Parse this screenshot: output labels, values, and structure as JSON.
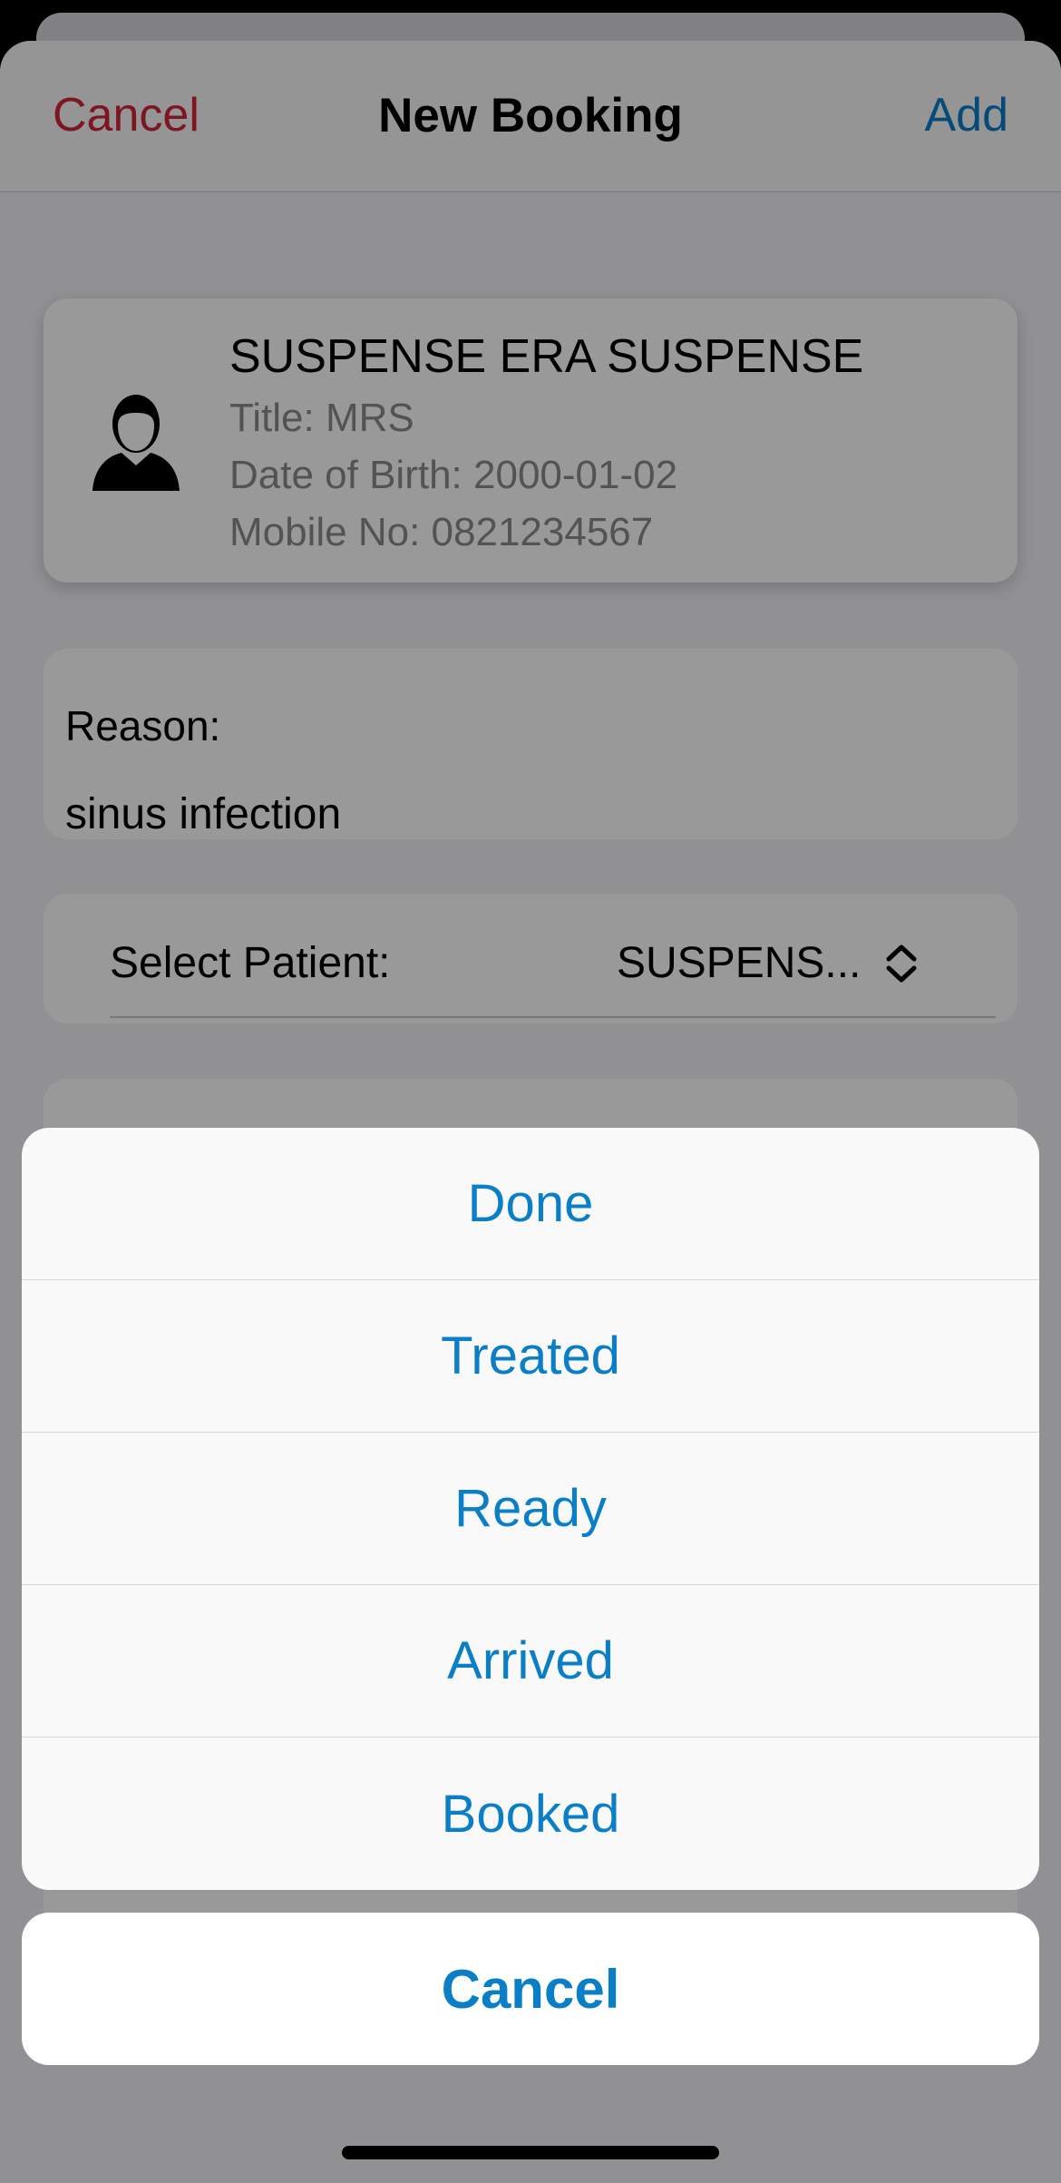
{
  "navbar": {
    "cancel_label": "Cancel",
    "title": "New Booking",
    "add_label": "Add"
  },
  "patient": {
    "icon": "person-icon",
    "name": "SUSPENSE ERA SUSPENSE",
    "title_line": "Title: MRS",
    "dob_line": "Date of Birth: 2000-01-02",
    "mobile_line": "Mobile No: 0821234567"
  },
  "reason": {
    "label": "Reason:",
    "value": "sinus infection"
  },
  "select_patient": {
    "label": "Select Patient:",
    "value": "SUSPENS...",
    "icon": "chevron-up-down-icon"
  },
  "action_sheet": {
    "options": [
      {
        "label": "Done"
      },
      {
        "label": "Treated"
      },
      {
        "label": "Ready"
      },
      {
        "label": "Arrived"
      },
      {
        "label": "Booked"
      }
    ],
    "cancel_label": "Cancel"
  },
  "colors": {
    "accent": "#0a7ec6",
    "destructive": "#d0233a"
  }
}
